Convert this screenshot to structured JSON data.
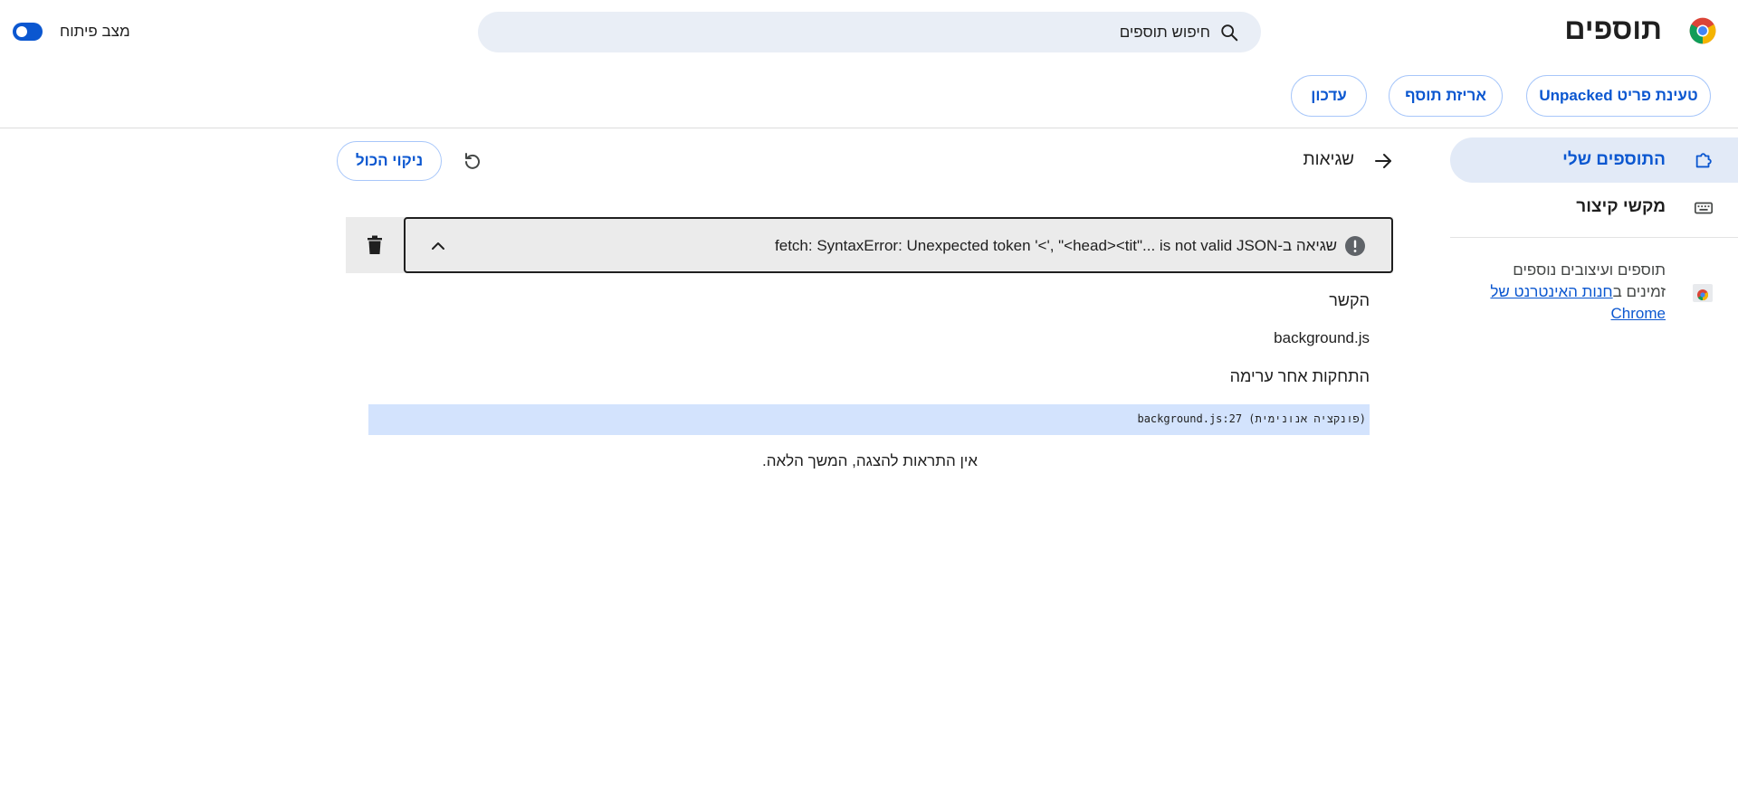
{
  "header": {
    "title": "תוספים",
    "search_placeholder": "חיפוש תוספים",
    "dev_mode_label": "מצב פיתוח",
    "dev_mode_on": true
  },
  "toolbar": {
    "load_unpacked": "טעינת פריט Unpacked",
    "pack_extension": "אריזת תוסף",
    "update": "עדכון"
  },
  "sidebar": {
    "items": [
      {
        "label": "התוספים שלי",
        "icon": "extension-puzzle-icon",
        "active": true
      },
      {
        "label": "מקשי קיצור",
        "icon": "keyboard-icon",
        "active": false
      }
    ],
    "promo_text": "תוספים ועיצובים נוספים זמינים ב",
    "promo_link": "חנות האינטרנט של Chrome"
  },
  "main": {
    "section_title": "שגיאות",
    "clear_all": "ניקוי הכול",
    "error": {
      "message": "שגיאה ב-fetch: SyntaxError: Unexpected token '<', \"<head><tit\"... is not valid JSON"
    },
    "context_label": "הקשר",
    "context_value": "background.js",
    "stack_label": "התחקות אחר ערימה",
    "stack_frame": "background.js:27 (פונקציה אנונימית)",
    "no_more": "אין התראות להצגה, המשך הלאה."
  },
  "colors": {
    "accent": "#0b57d0",
    "active_nav_bg": "#e2eaf7",
    "search_bg": "#e9eef6",
    "trace_highlight": "#d3e3fd",
    "error_row_bg": "#ebebeb"
  }
}
